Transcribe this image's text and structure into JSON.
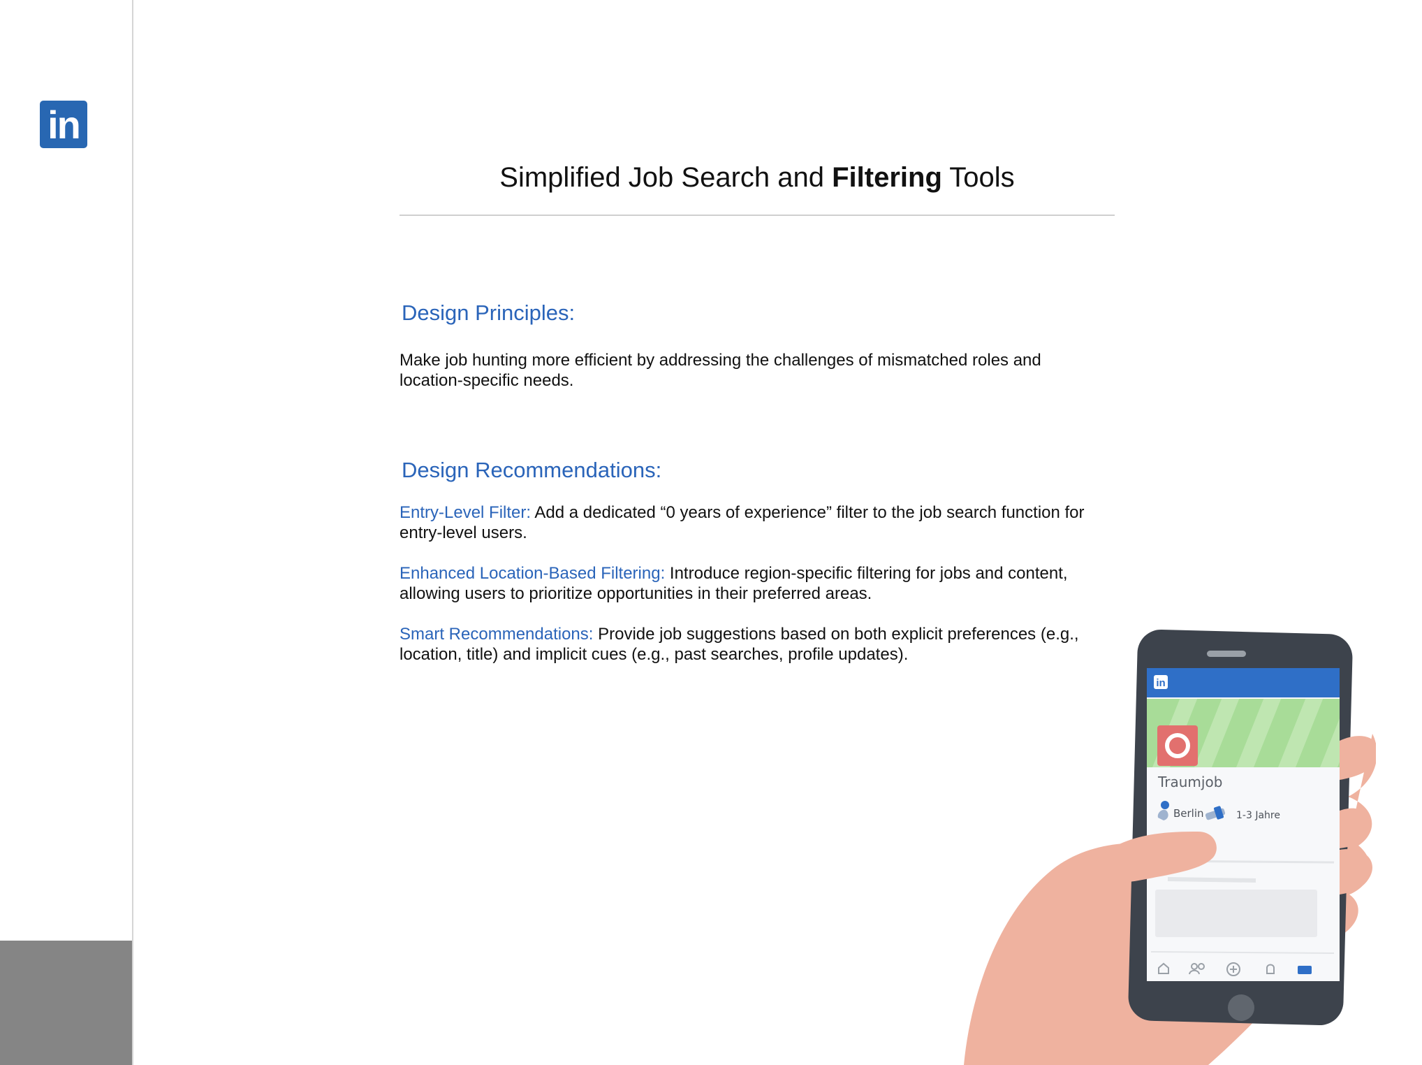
{
  "logo": {
    "text": "in",
    "color": "#2867b2"
  },
  "title": {
    "part1": "Simplified Job Search and ",
    "bold": "Filtering",
    "part2": " Tools"
  },
  "principles": {
    "heading": "Design Principles:",
    "body": "Make job hunting more efficient by addressing the challenges of mismatched roles and location-specific needs."
  },
  "recommendations": {
    "heading": "Design Recommendations:",
    "items": [
      {
        "label": "Entry-Level Filter:",
        "text": " Add a dedicated “0 years of experience” filter to the job search function for entry-level users."
      },
      {
        "label": "Enhanced Location-Based Filtering:",
        "text": " Introduce region-specific filtering for jobs and content, allowing users to prioritize opportunities in their preferred areas."
      },
      {
        "label": "Smart Recommendations:",
        "text": " Provide job suggestions based on both explicit preferences (e.g., location, title) and implicit cues (e.g., past searches, profile updates)."
      }
    ]
  },
  "phone": {
    "app_logo": "in",
    "job_title": "Traumjob",
    "location": "Berlin",
    "experience": "1-3 Jahre"
  },
  "colors": {
    "accent": "#2a64b9",
    "sidebar_block": "#858585",
    "hand": "#efb29f",
    "phone_body": "#3d434c",
    "banner_green": "#a8dc98"
  }
}
